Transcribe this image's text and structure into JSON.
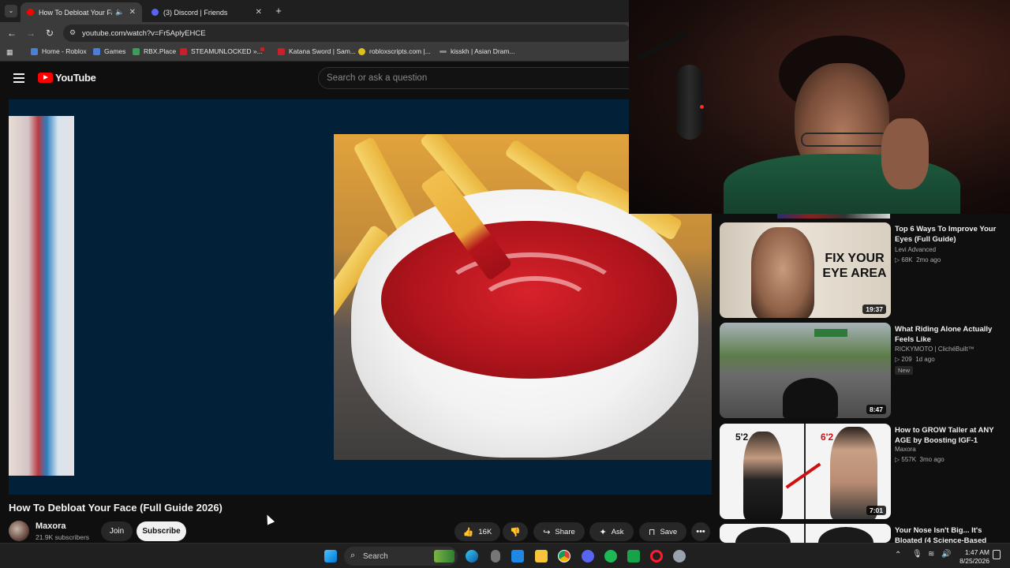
{
  "browser": {
    "tabs": [
      {
        "title": "How To Debloat Your Face (",
        "active": true,
        "favicon_color": "#ff0000"
      },
      {
        "title": "(3) Discord | Friends",
        "active": false,
        "favicon_color": "#5865f2"
      }
    ],
    "url": "youtube.com/watch?v=Fr5AplyEHCE",
    "bookmarks": [
      {
        "label": "Home - Roblox",
        "color": "#4a7fd9"
      },
      {
        "label": "Games",
        "color": "#4a7fd9"
      },
      {
        "label": "RBX.Place",
        "color": "#3c9c5a"
      },
      {
        "label": "STEAMUNLOCKED »...",
        "color": "#c8202a"
      },
      {
        "label": "",
        "color": "#c8202a"
      },
      {
        "label": "Katana Sword | Sam...",
        "color": "#c8202a"
      },
      {
        "label": "robloxscripts.com |...",
        "color": "#e0c020"
      },
      {
        "label": "kisskh | Asian Dram...",
        "color": "#888888"
      }
    ]
  },
  "youtube": {
    "logo_text": "YouTube",
    "search_placeholder": "Search or ask a question"
  },
  "video": {
    "title": "How To Debloat Your Face (Full Guide 2026)",
    "channel": "Maxora",
    "subscribers": "21.9K subscribers",
    "join_label": "Join",
    "subscribe_label": "Subscribe",
    "likes": "16K",
    "share_label": "Share",
    "ask_label": "Ask",
    "save_label": "Save"
  },
  "recommendations": [
    {
      "title": "Top 6 Ways To Improve Your Eyes (Full Guide)",
      "channel": "Levi Advanced",
      "views": "68K",
      "age": "2mo ago",
      "duration": "19:37",
      "thumb_text": "FIX YOUR EYE AREA",
      "badge": ""
    },
    {
      "title": "What Riding Alone Actually Feels Like",
      "channel": "RICKYMOTO | ClichéBuilt™",
      "views": "209",
      "age": "1d ago",
      "duration": "8:47",
      "thumb_text": "",
      "badge": "New"
    },
    {
      "title": "How to GROW Taller at ANY AGE by Boosting IGF-1",
      "channel": "Maxora",
      "views": "557K",
      "age": "3mo ago",
      "duration": "7:01",
      "thumb_text_left": "5'2",
      "thumb_text_right": "6'2",
      "badge": ""
    },
    {
      "title": "Your Nose Isn't Big... It's Bloated (4 Science-Based",
      "channel": "",
      "views": "",
      "age": "",
      "duration": "",
      "badge": ""
    }
  ],
  "taskbar": {
    "search_label": "Search",
    "time": "1:47 AM",
    "date": "8/25/2026"
  }
}
